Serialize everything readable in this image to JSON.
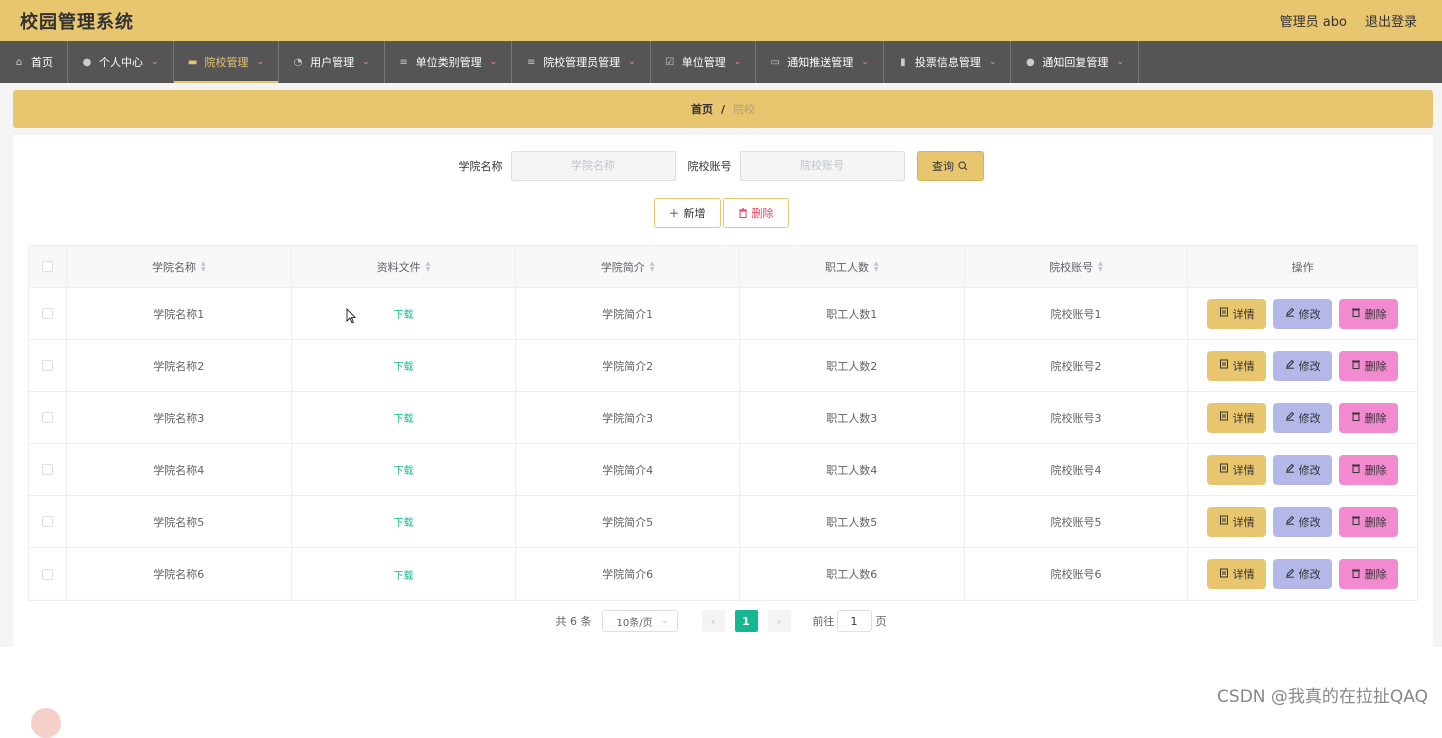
{
  "app": {
    "title": "校园管理系统",
    "user_label": "管理员 abo",
    "logout_label": "退出登录"
  },
  "nav": [
    {
      "label": "首页",
      "icon": "home-icon",
      "glyph": "⌂",
      "has_dropdown": false,
      "active": false
    },
    {
      "label": "个人中心",
      "icon": "user-icon",
      "glyph": "●",
      "has_dropdown": true,
      "active": false
    },
    {
      "label": "院校管理",
      "icon": "building-icon",
      "glyph": "▬",
      "has_dropdown": true,
      "active": true
    },
    {
      "label": "用户管理",
      "icon": "dashboard-icon",
      "glyph": "◔",
      "has_dropdown": true,
      "active": false
    },
    {
      "label": "单位类别管理",
      "icon": "menu-icon",
      "glyph": "≡",
      "has_dropdown": true,
      "active": false
    },
    {
      "label": "院校管理员管理",
      "icon": "menu-icon",
      "glyph": "≡",
      "has_dropdown": true,
      "active": false
    },
    {
      "label": "单位管理",
      "icon": "check-icon",
      "glyph": "☑",
      "has_dropdown": true,
      "active": false
    },
    {
      "label": "通知推送管理",
      "icon": "briefcase-icon",
      "glyph": "▭",
      "has_dropdown": true,
      "active": false
    },
    {
      "label": "投票信息管理",
      "icon": "chart-icon",
      "glyph": "▮",
      "has_dropdown": true,
      "active": false
    },
    {
      "label": "通知回复管理",
      "icon": "user-icon",
      "glyph": "●",
      "has_dropdown": true,
      "active": false
    }
  ],
  "breadcrumb": {
    "home": "首页",
    "separator": "/",
    "current": "院校"
  },
  "search": {
    "college_label": "学院名称",
    "college_placeholder": "学院名称",
    "account_label": "院校账号",
    "account_placeholder": "院校账号",
    "query_label": "查询"
  },
  "actions": {
    "add_label": "新增",
    "delete_label": "删除"
  },
  "table": {
    "headers": [
      "学院名称",
      "资料文件",
      "学院简介",
      "职工人数",
      "院校账号",
      "操作"
    ],
    "rows": [
      {
        "name": "学院名称1",
        "file": "下载",
        "intro": "学院简介1",
        "staff": "职工人数1",
        "account": "院校账号1"
      },
      {
        "name": "学院名称2",
        "file": "下载",
        "intro": "学院简介2",
        "staff": "职工人数2",
        "account": "院校账号2"
      },
      {
        "name": "学院名称3",
        "file": "下载",
        "intro": "学院简介3",
        "staff": "职工人数3",
        "account": "院校账号3"
      },
      {
        "name": "学院名称4",
        "file": "下载",
        "intro": "学院简介4",
        "staff": "职工人数4",
        "account": "院校账号4"
      },
      {
        "name": "学院名称5",
        "file": "下载",
        "intro": "学院简介5",
        "staff": "职工人数5",
        "account": "院校账号5"
      },
      {
        "name": "学院名称6",
        "file": "下载",
        "intro": "学院简介6",
        "staff": "职工人数6",
        "account": "院校账号6"
      }
    ],
    "row_actions": {
      "detail": "详情",
      "edit": "修改",
      "delete": "删除"
    }
  },
  "pagination": {
    "total": "共 6 条",
    "page_size": "10条/页",
    "current": "1",
    "goto_label": "前往",
    "goto_value": "1",
    "page_suffix": "页"
  },
  "watermark": "CSDN @我真的在拉扯QAQ",
  "colors": {
    "primary": "#e8c56f",
    "nav_bg": "#555555",
    "success": "#16b893",
    "edit": "#b3b8e8",
    "delete": "#f28ad0"
  }
}
